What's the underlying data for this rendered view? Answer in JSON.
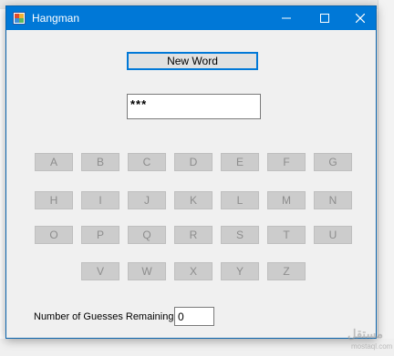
{
  "window": {
    "title": "Hangman",
    "minimize_glyph": "—",
    "maximize_glyph": "☐",
    "close_glyph": "✕"
  },
  "new_word_button": "New Word",
  "word_display": "***",
  "letters": [
    "A",
    "B",
    "C",
    "D",
    "E",
    "F",
    "G",
    "H",
    "I",
    "J",
    "K",
    "L",
    "M",
    "N",
    "O",
    "P",
    "Q",
    "R",
    "S",
    "T",
    "U",
    "V",
    "W",
    "X",
    "Y",
    "Z"
  ],
  "guesses": {
    "label": "Number of Guesses Remaining",
    "value": "0"
  },
  "watermark": {
    "text": "مستقل",
    "sub": "mostaql.com"
  },
  "colors": {
    "titlebar": "#0078d7",
    "window_bg": "#f0f0f0",
    "letter_disabled_bg": "#cccccc",
    "letter_disabled_text": "#8d8d8d"
  }
}
